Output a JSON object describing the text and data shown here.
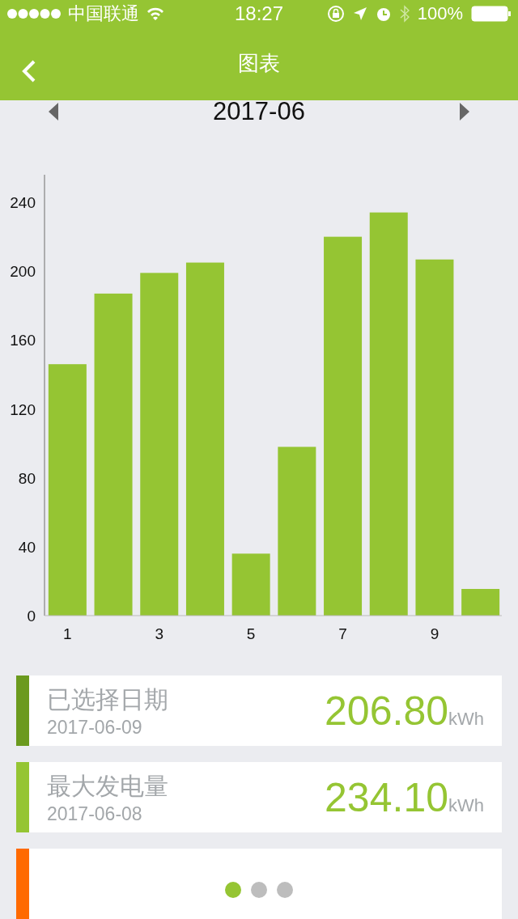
{
  "status_bar": {
    "carrier": "中国联通",
    "time": "18:27",
    "battery": "100%"
  },
  "nav_bar": {
    "title": "图表"
  },
  "month_nav": {
    "label": "2017-06"
  },
  "chart": {
    "chart_data": {
      "type": "bar",
      "x": [
        1,
        2,
        3,
        4,
        5,
        6,
        7,
        8,
        9,
        10
      ],
      "series": [
        {
          "color": "#95c533",
          "values": [
            146,
            187,
            199,
            205,
            36,
            98,
            220,
            234.1,
            206.8,
            15.5
          ]
        }
      ],
      "xlim": [
        0.5,
        10.5
      ],
      "ylim": [
        0,
        256
      ],
      "yticks": [
        0,
        40,
        80,
        120,
        160,
        200,
        240
      ],
      "xticks": [
        1,
        3,
        5,
        7,
        9
      ]
    }
  },
  "cards": [
    {
      "title": "已选择日期",
      "date": "2017-06-09",
      "value": "206.80",
      "unit": "kWh",
      "color": "#6b9a1e"
    },
    {
      "title": "最大发电量",
      "date": "2017-06-08",
      "value": "234.10",
      "unit": "kWh",
      "color": "#95c533"
    },
    {
      "color": "#ff6a00"
    }
  ],
  "pager": [
    {
      "selected": true
    },
    {
      "selected": false
    },
    {
      "selected": false
    }
  ]
}
